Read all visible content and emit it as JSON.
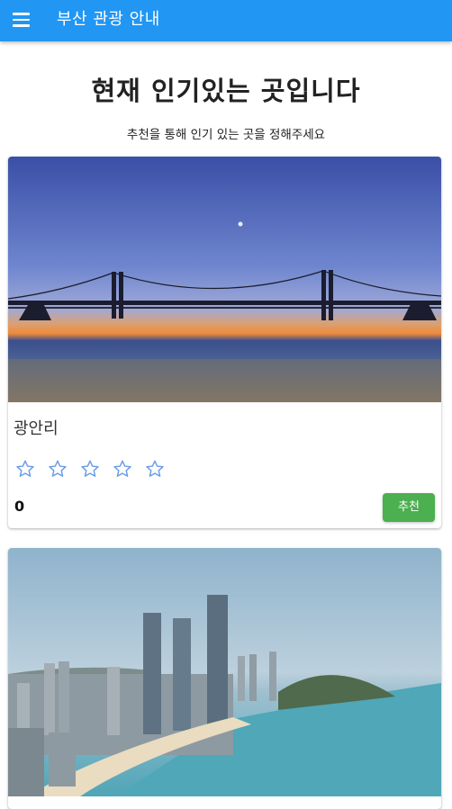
{
  "appbar": {
    "title": "부산 관광 안내",
    "menu_icon": "hamburger-menu-icon",
    "color": "#2196f3"
  },
  "main": {
    "heading": "현재 인기있는 곳입니다",
    "subheading": "추천을 통해 인기 있는 곳을 정해주세요"
  },
  "cards": [
    {
      "name": "광안리",
      "rating_max": 5,
      "rating": 0,
      "star_icon": "star-outline-icon",
      "count": "0",
      "button_label": "추천",
      "button_color": "#4caf50",
      "image": "Gwangan Bridge over the sea at dusk"
    },
    {
      "image": "Haeundae beach skyline with high-rise towers"
    }
  ]
}
